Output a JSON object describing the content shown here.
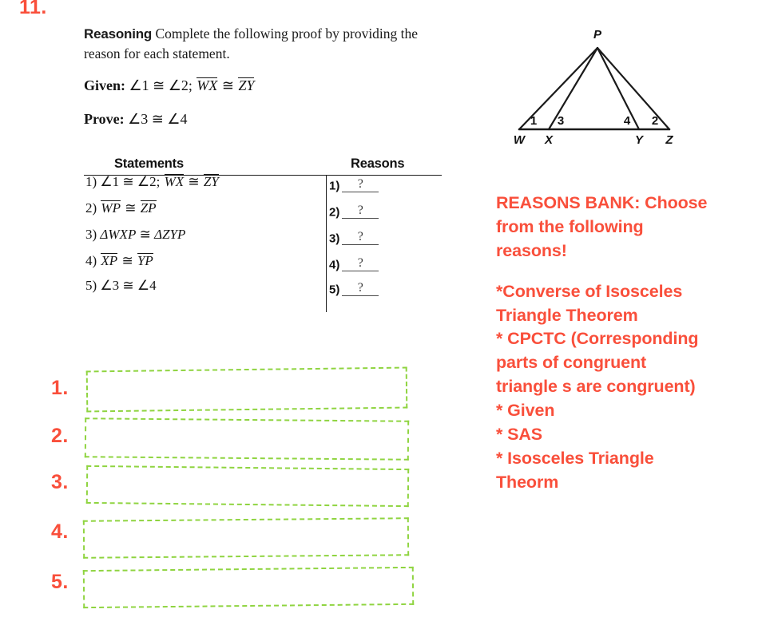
{
  "problem": {
    "number": "11."
  },
  "prompt": {
    "lead": "Reasoning",
    "text": "Complete the following proof by providing the reason for each statement.",
    "given_label": "Given:",
    "given_angles": "∠1 ≅ ∠2;",
    "given_seg_1": "WX",
    "given_cong": "≅",
    "given_seg_2": "ZY",
    "prove_label": "Prove:",
    "prove_text": "∠3 ≅ ∠4"
  },
  "proof_table": {
    "headers": {
      "statements": "Statements",
      "reasons": "Reasons"
    },
    "statements": [
      {
        "num": "1)",
        "parts": [
          {
            "type": "text",
            "value": "∠1 ≅ ∠2;"
          },
          {
            "type": "seg",
            "value": "WX"
          },
          {
            "type": "text",
            "value": "≅"
          },
          {
            "type": "seg",
            "value": "ZY"
          }
        ]
      },
      {
        "num": "2)",
        "parts": [
          {
            "type": "seg",
            "value": "WP"
          },
          {
            "type": "text",
            "value": "≅"
          },
          {
            "type": "seg",
            "value": "ZP"
          }
        ]
      },
      {
        "num": "3)",
        "parts": [
          {
            "type": "ital",
            "value": "ΔWXP"
          },
          {
            "type": "text",
            "value": "≅"
          },
          {
            "type": "ital",
            "value": "ΔZYP"
          }
        ]
      },
      {
        "num": "4)",
        "parts": [
          {
            "type": "seg",
            "value": "XP"
          },
          {
            "type": "text",
            "value": "≅"
          },
          {
            "type": "seg",
            "value": "YP"
          }
        ]
      },
      {
        "num": "5)",
        "parts": [
          {
            "type": "text",
            "value": "∠3 ≅ ∠4"
          }
        ]
      }
    ],
    "reasons": [
      {
        "num": "1)",
        "value": "?"
      },
      {
        "num": "2)",
        "value": "?"
      },
      {
        "num": "3)",
        "value": "?"
      },
      {
        "num": "4)",
        "value": "?"
      },
      {
        "num": "5)",
        "value": "?"
      }
    ]
  },
  "figure": {
    "apex_label": "P",
    "base_labels": [
      "W",
      "X",
      "Y",
      "Z"
    ],
    "angle_labels": [
      "1",
      "3",
      "4",
      "2"
    ],
    "stroke_color": "#1a1a1a"
  },
  "reasons_bank": {
    "heading_line_1": "REASONS BANK:  Choose",
    "heading_line_2": "from the following",
    "heading_line_3": "reasons!",
    "items": [
      "*Converse of Isosceles",
      "Triangle Theorem",
      "* CPCTC (Corresponding",
      "parts of congruent",
      "triangle s are congruent)",
      "* Given",
      "* SAS",
      "* Isosceles Triangle",
      "Theorm"
    ]
  },
  "answers": {
    "numbers": [
      "1.",
      "2.",
      "3.",
      "4.",
      "5."
    ],
    "values": [
      "",
      "",
      "",
      "",
      ""
    ]
  },
  "colors": {
    "red": "#f94f3b",
    "green": "#8fd440",
    "ink": "#1a1a1a"
  }
}
